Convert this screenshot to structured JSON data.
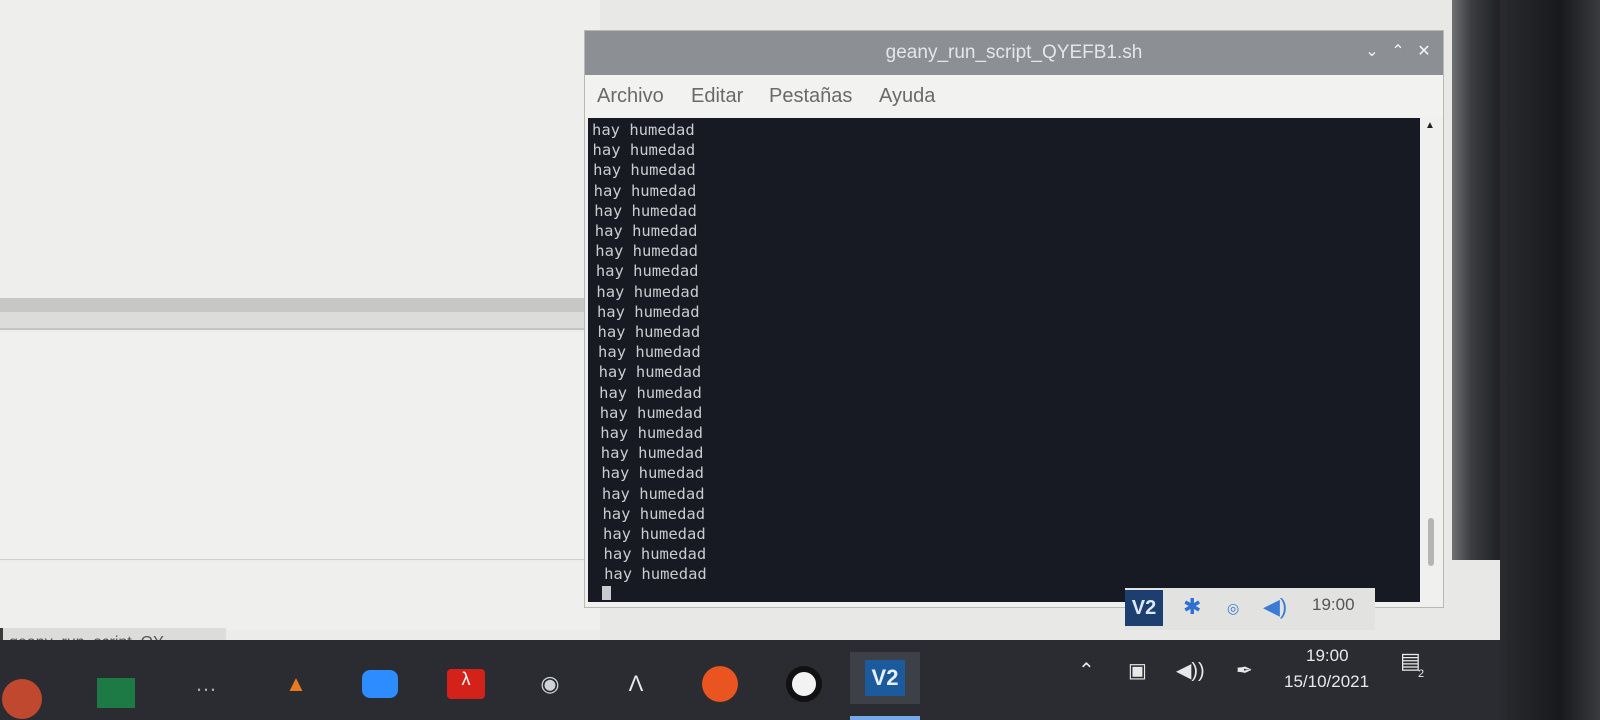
{
  "terminal_window": {
    "title": "geany_run_script_QYEFB1.sh",
    "menu": [
      "Archivo",
      "Editar",
      "Pestañas",
      "Ayuda"
    ],
    "lines": [
      "hay humedad",
      "hay humedad",
      "hay humedad",
      "hay humedad",
      "hay humedad",
      "hay humedad",
      "hay humedad",
      "hay humedad",
      "hay humedad",
      "hay humedad",
      "hay humedad",
      "hay humedad",
      "hay humedad",
      "hay humedad",
      "hay humedad",
      "hay humedad",
      "hay humedad",
      "hay humedad",
      "hay humedad",
      "hay humedad",
      "hay humedad",
      "hay humedad",
      "hay humedad"
    ]
  },
  "geany_status": "geany_run_script_QY...",
  "pi_panel": {
    "vnc_label": "V2",
    "clock": "19:00"
  },
  "windows_taskbar": {
    "time": "19:00",
    "date": "15/10/2021",
    "notification_count": "2",
    "active_app_label": "V2"
  },
  "colors": {
    "terminal_bg": "#171a22",
    "terminal_fg": "#c9cbce",
    "titlebar": "#8c9094",
    "taskbar": "#2a2c31",
    "vnc_blue": "#1c3f70"
  }
}
